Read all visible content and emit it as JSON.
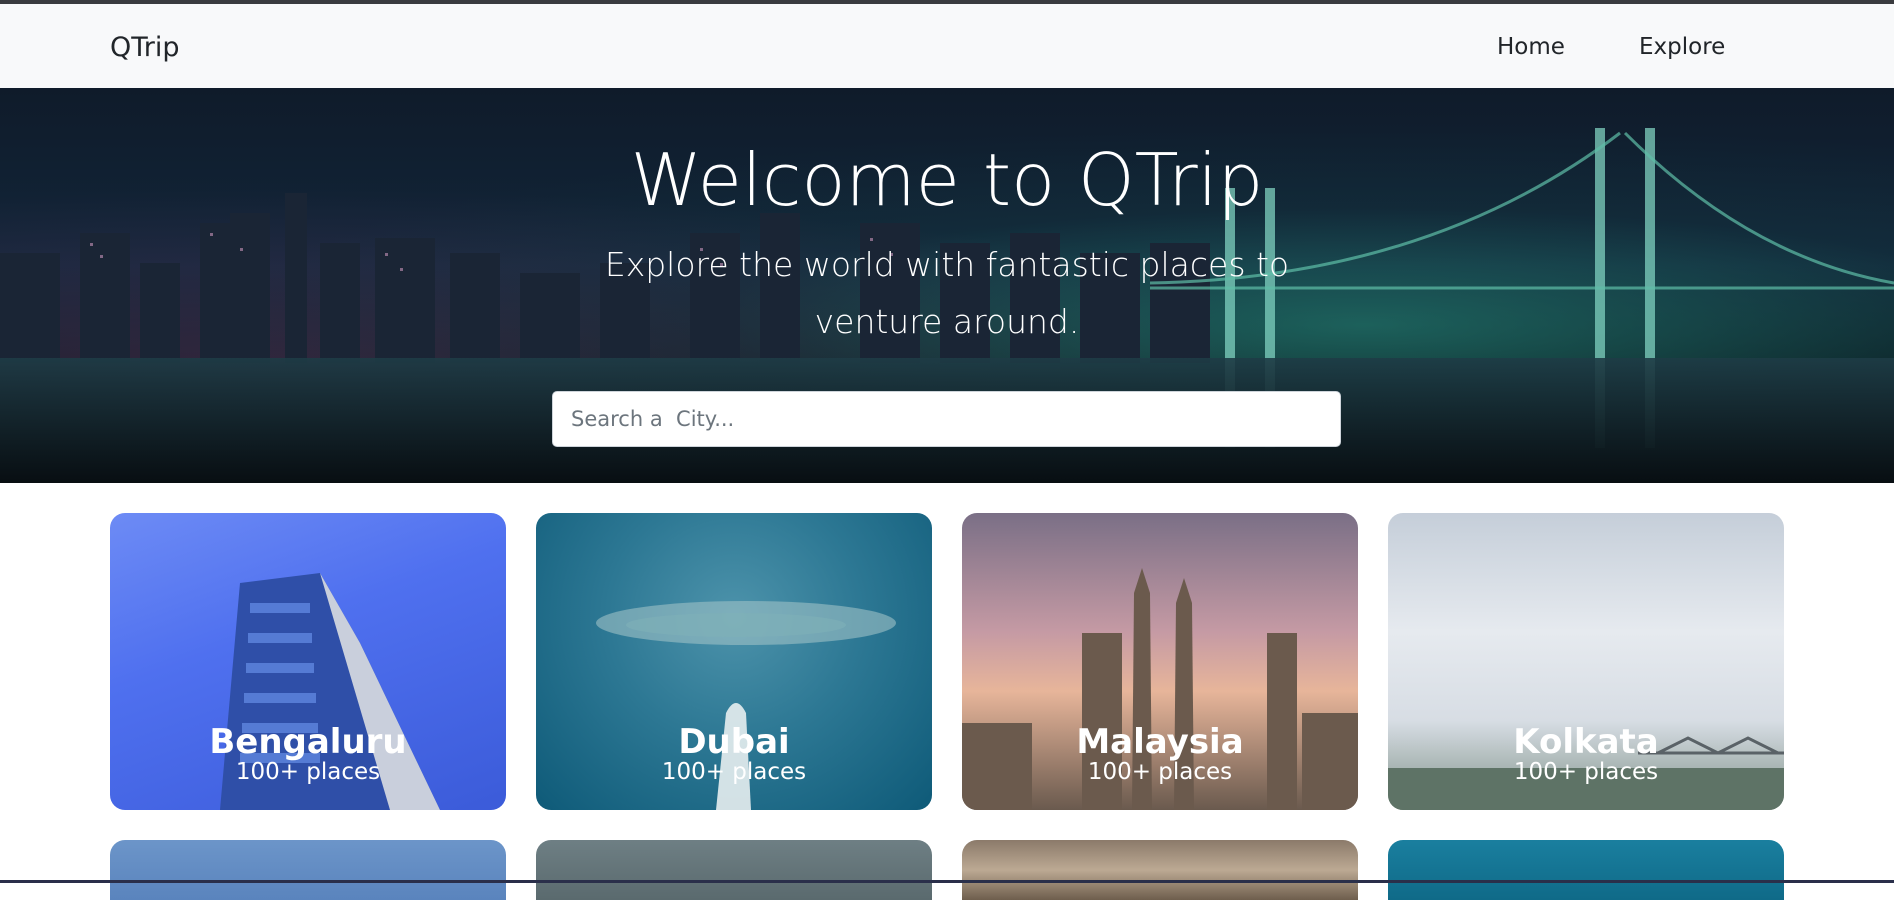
{
  "navbar": {
    "brand": "QTrip",
    "links": [
      {
        "label": "Home"
      },
      {
        "label": "Explore"
      }
    ]
  },
  "hero": {
    "title": "Welcome to QTrip",
    "subtitle": "Explore the world with fantastic places to venture around.",
    "search": {
      "placeholder": "Search a  City...",
      "value": ""
    }
  },
  "cities": [
    {
      "name": "Bengaluru",
      "places": "100+ places"
    },
    {
      "name": "Dubai",
      "places": "100+ places"
    },
    {
      "name": "Malaysia",
      "places": "100+ places"
    },
    {
      "name": "Kolkata",
      "places": "100+ places"
    }
  ],
  "colors": {
    "navbar_bg": "#f8f9fa",
    "text_dark": "#212529",
    "hero_text": "#ffffff"
  }
}
